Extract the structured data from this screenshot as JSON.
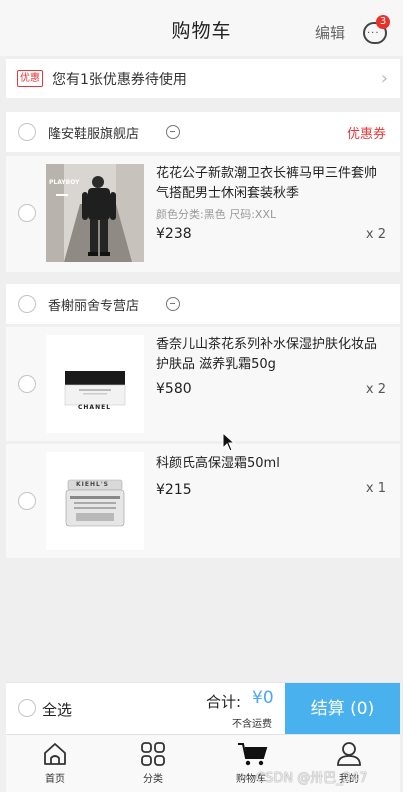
{
  "header": {
    "title": "购物车",
    "edit_label": "编辑",
    "message_badge": "3"
  },
  "coupon_bar": {
    "tag": "优惠",
    "text": "您有1张优惠券待使用"
  },
  "shops": [
    {
      "name": "隆安鞋服旗舰店",
      "coupon_label": "优惠券",
      "items": [
        {
          "title": "花花公子新款潮卫衣长裤马甲三件套帅气搭配男士休闲套装秋季",
          "spec": "颜色分类:黑色 尺码:XXL",
          "price": "¥238",
          "qty": "x 2",
          "thumb_text": "PLAYBOY"
        }
      ]
    },
    {
      "name": "香榭丽舍专营店",
      "coupon_label": "",
      "items": [
        {
          "title": "香奈儿山茶花系列补水保湿护肤化妆品护肤品 滋养乳霜50g",
          "spec": "",
          "price": "¥580",
          "qty": "x 2",
          "thumb_text": "CHANEL"
        },
        {
          "title": "科颜氏高保湿霜50ml",
          "spec": "",
          "price": "¥215",
          "qty": "x 1",
          "thumb_text": "KIEHL'S"
        }
      ]
    }
  ],
  "footer": {
    "select_all": "全选",
    "total_label": "合计:",
    "total_value": "¥0",
    "shipping_note": "不含运费",
    "checkout_label": "结算 (0)"
  },
  "tabbar": [
    {
      "label": "首页",
      "icon": "home-icon"
    },
    {
      "label": "分类",
      "icon": "category-icon"
    },
    {
      "label": "购物车",
      "icon": "cart-icon"
    },
    {
      "label": "我的",
      "icon": "user-icon"
    }
  ],
  "watermark": "CSDN @卅巴_247",
  "colors": {
    "accent": "#4ab1ef",
    "price_total": "#4aa8f0",
    "coupon_red": "#e4393c",
    "badge_red": "#e7322c"
  }
}
